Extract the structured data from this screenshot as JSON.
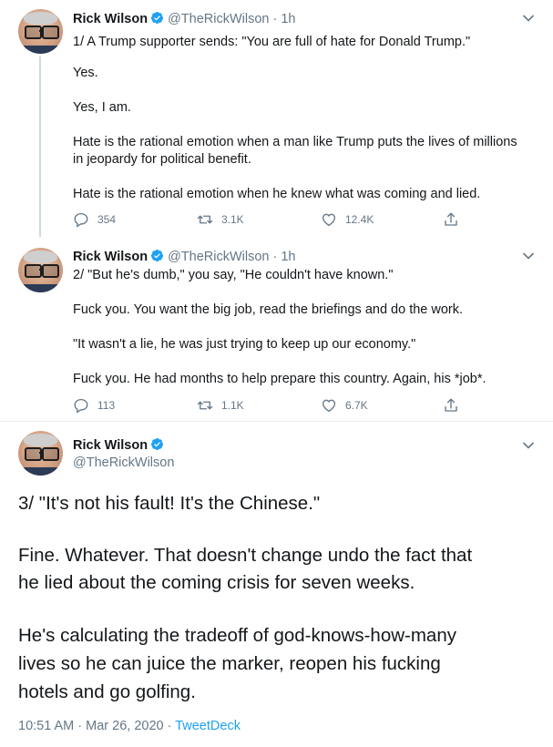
{
  "colors": {
    "accent": "#1da1f2",
    "secondary_text": "#657786",
    "primary_text": "#14171a"
  },
  "author": {
    "name": "Rick Wilson",
    "handle": "@TheRickWilson"
  },
  "tweets": [
    {
      "time": "· 1h",
      "lines": [
        "1/ A Trump supporter sends: \"You are full of hate for Donald Trump.\"",
        "Yes.",
        "Yes, I am.",
        "Hate is the rational emotion when a man like Trump puts the lives of millions",
        "in jeopardy for political benefit.",
        "Hate is the rational emotion when he knew what was coming and lied."
      ],
      "replies": "354",
      "retweets": "3.1K",
      "likes": "12.4K"
    },
    {
      "time": "· 1h",
      "lines": [
        "2/ \"But he's dumb,\" you say, \"He couldn't have known.\"",
        "Fuck you. You want the big job, read the briefings and do the work.",
        "\"It wasn't a lie, he was just trying to keep up our economy.\"",
        "Fuck you. He had months to help prepare this country. Again, his *job*."
      ],
      "replies": "113",
      "retweets": "1.1K",
      "likes": "6.7K"
    },
    {
      "lines": [
        "3/ \"It's not his fault! It's the Chinese.\"",
        "Fine. Whatever. That doesn't change undo the fact that",
        "he lied about the coming crisis for seven weeks.",
        "He's calculating the tradeoff of god-knows-how-many",
        "lives so he can juice the marker, reopen his fucking",
        "hotels and go golfing."
      ],
      "timestamp": "10:51 AM · Mar 26, 2020",
      "separator": " · ",
      "source": "TweetDeck"
    }
  ],
  "icons": [
    "reply-icon",
    "retweet-icon",
    "like-icon",
    "share-icon",
    "verified-icon",
    "chevron-down-icon"
  ]
}
